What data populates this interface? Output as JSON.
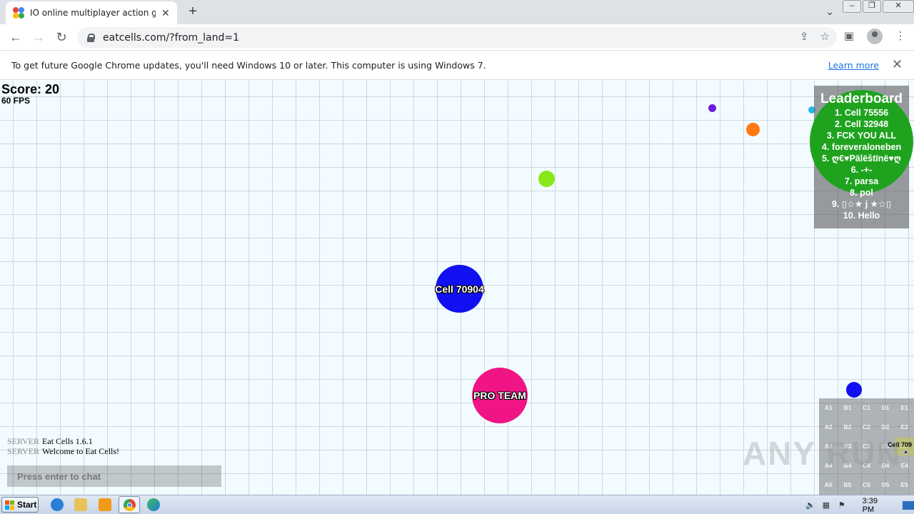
{
  "tab": {
    "title": "IO online multiplayer action game. Start",
    "close": "✕"
  },
  "newtab": "+",
  "toolbar": {
    "url": "eatcells.com/?from_land=1"
  },
  "infobar": {
    "text": "To get future Google Chrome updates, you'll need Windows 10 or later. This computer is using Windows 7.",
    "link": "Learn more",
    "close": "✕"
  },
  "game": {
    "score": "Score: 20",
    "fps": "60 FPS",
    "cells": [
      {
        "name": "Cell 70904",
        "color": "#1010f0"
      },
      {
        "name": "PRO TEAM",
        "color": "#f01484"
      }
    ],
    "food_colors": [
      "#6a1fd6",
      "#ff7a10",
      "#88e81a",
      "#21b8e8",
      "#1010f0"
    ],
    "leaderboard": {
      "title": "Leaderboard",
      "items": [
        "1. Cell 75556",
        "2. Cell 32948",
        "3. FCK YOU ALL",
        "4. foreveraloneben",
        "5. ღ€♥Pälëštïnë♥ღ",
        "6. -+-",
        "7. parsa",
        "8. pol",
        "9. ▯☆★ j ★☆▯",
        "10. Hello"
      ]
    },
    "chat": {
      "messages": [
        {
          "sender": "SERVER",
          "text": "Eat Cells 1.6.1"
        },
        {
          "sender": "SERVER",
          "text": "Welcome to Eat Cells!"
        }
      ],
      "placeholder": "Press enter to chat"
    },
    "minimap": {
      "cells": [
        "A1",
        "B1",
        "C1",
        "D1",
        "E1",
        "A2",
        "B2",
        "C2",
        "D2",
        "E2",
        "A3",
        "B3",
        "C3",
        "D3",
        "E3",
        "A4",
        "B4",
        "C4",
        "D4",
        "E4",
        "A5",
        "B5",
        "C5",
        "D5",
        "E5"
      ],
      "player_label": "Cell 709"
    },
    "watermark": "ANY RUN"
  },
  "taskbar": {
    "start": "Start",
    "clock": "3:39 PM"
  }
}
